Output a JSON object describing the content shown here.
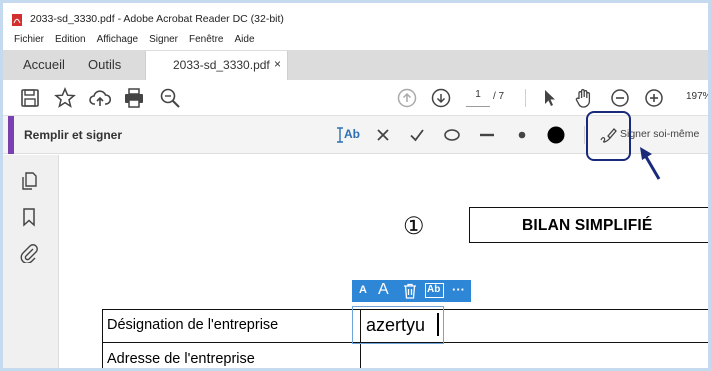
{
  "window": {
    "title": "2033-sd_3330.pdf - Adobe Acrobat Reader DC (32-bit)"
  },
  "menu": [
    "Fichier",
    "Edition",
    "Affichage",
    "Signer",
    "Fenêtre",
    "Aide"
  ],
  "tabs": {
    "home": "Accueil",
    "tools": "Outils",
    "document": "2033-sd_3330.pdf",
    "close": "×"
  },
  "toolbar": {
    "current_page": "1",
    "total_pages": "/ 7",
    "zoom": "197%"
  },
  "fill_sign": {
    "title": "Remplir et signer",
    "text_tool_label": "Ab",
    "sign_label": "Signer soi-même"
  },
  "document": {
    "section_number": "①",
    "heading": "BILAN SIMPLIFIÉ",
    "rows": [
      {
        "label": "Désignation de l'entreprise",
        "value": "azertyu"
      },
      {
        "label": "Adresse de l'entreprise"
      }
    ]
  },
  "float_toolbar": {
    "small_a": "A",
    "large_a": "A",
    "field_label": "Ab",
    "more": "···"
  },
  "colors": {
    "accent": "#7a3fb0",
    "float_toolbar": "#2d86d6",
    "highlight": "#1a2a7a"
  }
}
